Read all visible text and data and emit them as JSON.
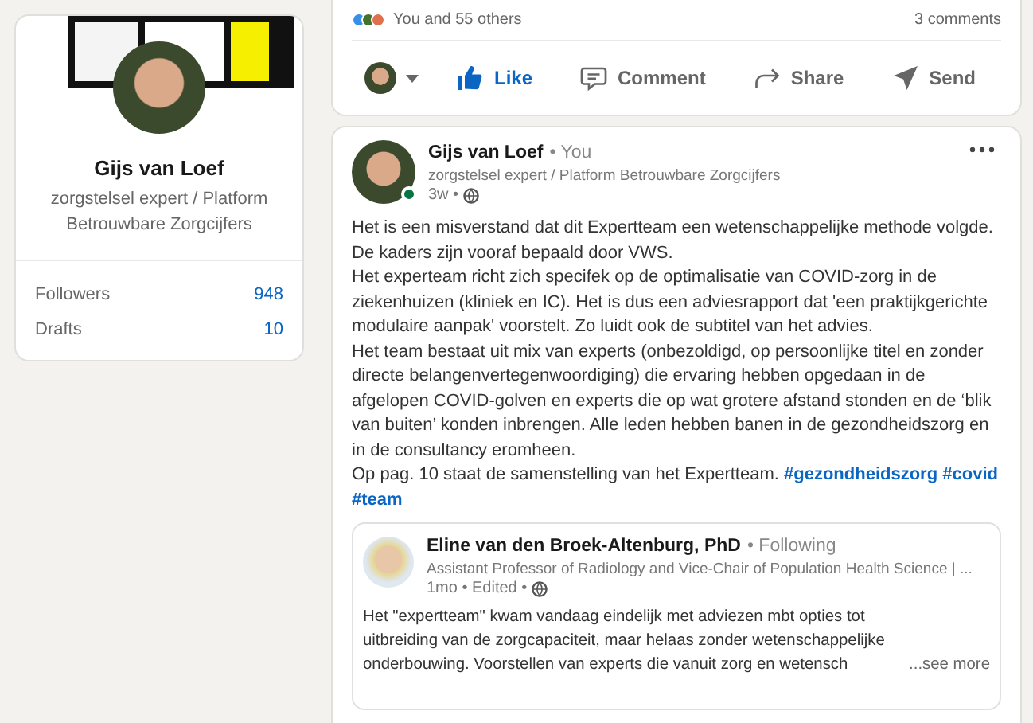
{
  "profile": {
    "name": "Gijs van Loef",
    "headline": "zorgstelsel expert / Platform Betrouwbare Zorgcijfers",
    "stats": [
      {
        "label": "Followers",
        "value": "948"
      },
      {
        "label": "Drafts",
        "value": "10"
      }
    ]
  },
  "previous_post": {
    "reactions": "You and 55 others",
    "comments": "3 comments",
    "actions": [
      {
        "kind": "like",
        "label": "Like",
        "selected": true
      },
      {
        "kind": "comment",
        "label": "Comment",
        "selected": false
      },
      {
        "kind": "share",
        "label": "Share",
        "selected": false
      },
      {
        "kind": "send",
        "label": "Send",
        "selected": false
      }
    ]
  },
  "post": {
    "author": "Gijs van Loef",
    "relation": "• You",
    "headline": "zorgstelsel expert / Platform Betrouwbare Zorgcijfers",
    "time": "3w •",
    "online": true,
    "paragraphs": [
      "Het is een misverstand dat dit Expertteam een wetenschappelijke methode volgde. De kaders zijn vooraf bepaald door VWS.",
      "Het experteam richt zich specifek op de optimalisatie van COVID-zorg in de ziekenhuizen (kliniek en IC). Het is dus een adviesrapport dat 'een praktijkgerichte modulaire aanpak' voorstelt. Zo luidt ook de subtitel van het advies.",
      "Het team bestaat uit mix van experts (onbezoldigd, op persoonlijke titel en zonder directe belangenvertegenwoordiging) die ervaring hebben opgedaan in de afgelopen COVID-golven en experts die op wat grotere afstand stonden en de ‘blik van buiten’ konden inbrengen. Alle leden hebben banen in de gezondheidszorg en in de consultancy eromheen.",
      "Op pag. 10 staat de samenstelling van het Expertteam."
    ],
    "hashtags": [
      "#gezondheidszorg",
      "#covid",
      "#team"
    ],
    "shared": {
      "author": "Eline van den Broek-Altenburg, PhD",
      "relation": "• Following",
      "headline": "Assistant Professor of Radiology and Vice-Chair of Population Health Science | ...",
      "time": "1mo • Edited •",
      "text": "Het \"expertteam\" kwam vandaag eindelijk met adviezen mbt opties tot uitbreiding van de zorgcapaciteit, maar helaas zonder wetenschappelijke onderbouwing. Voorstellen van experts die vanuit zorg en wetensch",
      "more": "...see more"
    }
  }
}
